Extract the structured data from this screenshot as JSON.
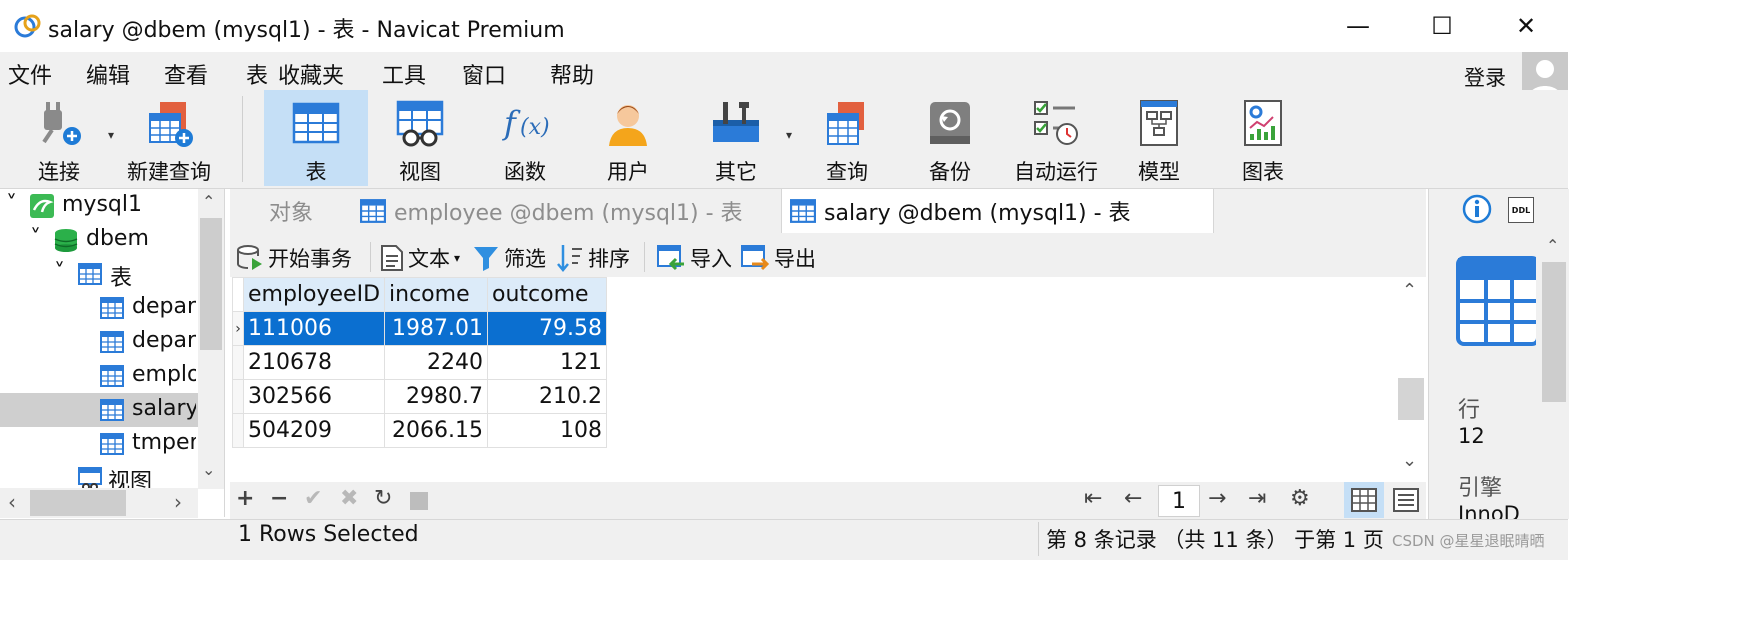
{
  "window": {
    "title": "salary @dbem (mysql1) - 表 - Navicat Premium",
    "controls": {
      "minimize": "—",
      "maximize": "☐",
      "close": "✕"
    }
  },
  "menu": [
    "文件",
    "编辑",
    "查看",
    "表",
    "收藏夹",
    "工具",
    "窗口",
    "帮助"
  ],
  "login_label": "登录",
  "toolbar": {
    "items": [
      {
        "label": "连接",
        "icon": "connect-plug-icon"
      },
      {
        "label": "新建查询",
        "icon": "new-query-icon"
      },
      {
        "label": "表",
        "icon": "table-icon",
        "active": true
      },
      {
        "label": "视图",
        "icon": "view-glasses-icon"
      },
      {
        "label": "函数",
        "icon": "function-fx-icon"
      },
      {
        "label": "用户",
        "icon": "user-icon"
      },
      {
        "label": "其它",
        "icon": "tools-icon"
      },
      {
        "label": "查询",
        "icon": "query-icon"
      },
      {
        "label": "备份",
        "icon": "backup-icon"
      },
      {
        "label": "自动运行",
        "icon": "automation-icon"
      },
      {
        "label": "模型",
        "icon": "model-icon"
      },
      {
        "label": "图表",
        "icon": "chart-icon"
      }
    ]
  },
  "tree": {
    "connection": "mysql1",
    "database": "dbem",
    "tables_folder": "表",
    "tables": [
      "depart",
      "depart",
      "emplo",
      "salary",
      "tmper"
    ],
    "selected_table": "salary",
    "views_folder": "视图"
  },
  "tabs": [
    {
      "label": "对象",
      "active": false
    },
    {
      "label": "employee @dbem (mysql1) - 表",
      "active": false
    },
    {
      "label": "salary @dbem (mysql1) - 表",
      "active": true
    }
  ],
  "table_toolbar": {
    "begin_transaction": "开始事务",
    "text": "文本",
    "filter": "筛选",
    "sort": "排序",
    "import": "导入",
    "export": "导出"
  },
  "grid": {
    "columns": [
      "employeeID",
      "income",
      "outcome"
    ],
    "rows": [
      {
        "employeeID": "111006",
        "income": "1987.01",
        "outcome": "79.58",
        "selected": true
      },
      {
        "employeeID": "210678",
        "income": "2240",
        "outcome": "121",
        "selected": false
      },
      {
        "employeeID": "302566",
        "income": "2980.7",
        "outcome": "210.2",
        "selected": false
      },
      {
        "employeeID": "504209",
        "income": "2066.15",
        "outcome": "108",
        "selected": false
      }
    ]
  },
  "pager": {
    "page": "1"
  },
  "status": {
    "left": "1 Rows Selected",
    "right": "第 8 条记录 （共 11 条） 于第 1 页"
  },
  "info_panel": {
    "rows_label": "行",
    "rows_value": "12",
    "engine_label": "引擎",
    "engine_value": "InnoD"
  },
  "watermark": "CSDN @星星退眠晴晒",
  "colors": {
    "selection": "#0b6fd0",
    "header_bg": "#dcebf9",
    "toolbar_active": "#c5dff6",
    "chrome": "#f0f0f0"
  }
}
